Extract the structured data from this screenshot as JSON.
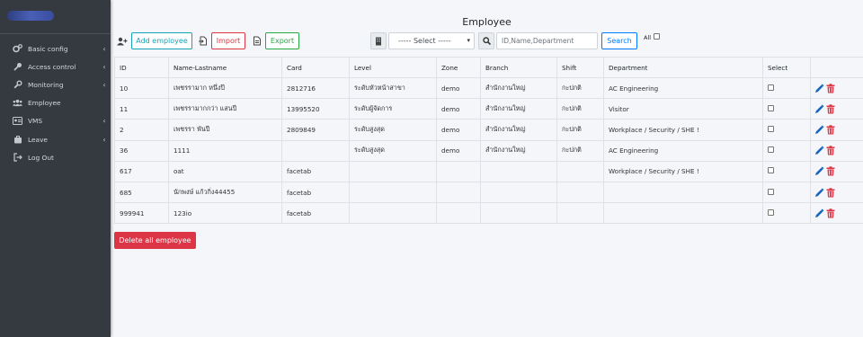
{
  "sidebar": {
    "items": [
      {
        "label": "Basic config",
        "icon": "cogs-icon",
        "has_submenu": true
      },
      {
        "label": "Access control",
        "icon": "key-icon",
        "has_submenu": true
      },
      {
        "label": "Monitoring",
        "icon": "wrench-icon",
        "has_submenu": true
      },
      {
        "label": "Employee",
        "icon": "users-icon",
        "has_submenu": false
      },
      {
        "label": "VMS",
        "icon": "id-card-icon",
        "has_submenu": true
      },
      {
        "label": "Leave",
        "icon": "leave-icon",
        "has_submenu": true
      },
      {
        "label": "Log Out",
        "icon": "logout-icon",
        "has_submenu": false
      }
    ]
  },
  "page": {
    "title": "Employee"
  },
  "toolbar": {
    "add_label": "Add employee",
    "import_label": "Import",
    "export_label": "Export",
    "select_value": "----- Select -----",
    "search_placeholder": "ID,Name,Department",
    "search_label": "Search",
    "all_label": "All"
  },
  "table": {
    "headers": [
      "ID",
      "Name-Lastname",
      "Card",
      "Level",
      "Zone",
      "Branch",
      "Shift",
      "Department",
      "Select",
      ""
    ],
    "rows": [
      [
        "10",
        "เพชรรามาก หนึ่งปี",
        "2812716",
        "ระดับหัวหน้าสาขา",
        "demo",
        "สำนักงานใหญ่",
        "กะปกติ",
        "AC Engineering"
      ],
      [
        "11",
        "เพชรรามากกว่า แสนปี",
        "13995520",
        "ระดับผู้จัดการ",
        "demo",
        "สำนักงานใหญ่",
        "กะปกติ",
        "Visitor"
      ],
      [
        "2",
        "เพชรรา พันปี",
        "2809849",
        "ระดับสูงสุด",
        "demo",
        "สำนักงานใหญ่",
        "กะปกติ",
        "Workplace / Security / SHE !"
      ],
      [
        "36",
        "1111",
        "",
        "ระดับสูงสุด",
        "demo",
        "สำนักงานใหญ่",
        "กะปกติ",
        "AC Engineering"
      ],
      [
        "617",
        "oat",
        "facetab",
        "",
        "",
        "",
        "",
        "Workplace / Security / SHE !"
      ],
      [
        "685",
        "นักพงษ์ แก้วกิ่ง44455",
        "facetab",
        "",
        "",
        "",
        "",
        ""
      ],
      [
        "999941",
        "123io",
        "facetab",
        "",
        "",
        "",
        "",
        ""
      ]
    ]
  },
  "footer": {
    "delete_all_label": "Delete all employee"
  },
  "colors": {
    "sidebar_bg": "#343a40",
    "info": "#17a2b8",
    "danger": "#dc3545",
    "success": "#28a745",
    "primary": "#007bff",
    "edit_icon": "#1565c0"
  }
}
